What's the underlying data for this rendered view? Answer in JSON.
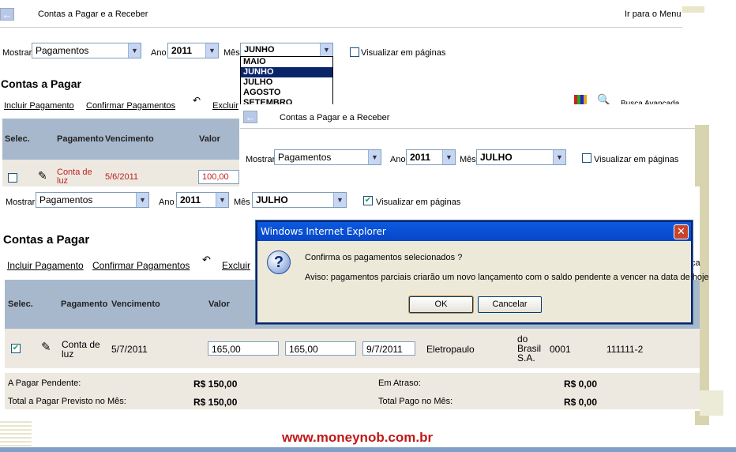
{
  "p1": {
    "title": "Contas a Pagar e a Receber",
    "menu": "Ir para o Menu",
    "mostrar_label": "Mostrar",
    "mostrar_val": "Pagamentos",
    "ano_label": "Ano",
    "ano_val": "2011",
    "mes_label": "Mês",
    "mes_val": "JUNHO",
    "vis_label": "Visualizar em páginas",
    "dropdown": [
      "MAIO",
      "JUNHO",
      "JULHO",
      "AGOSTO",
      "SETEMBRO"
    ],
    "heading": "Contas a Pagar",
    "incluir": "Incluir Pagamento",
    "confirmar": "Confirmar Pagamentos",
    "excluir": "Excluir",
    "busca": "Busca Avançada",
    "cols": [
      "Selec.",
      "Pagamento",
      "Vencimento",
      "Valor"
    ],
    "row": {
      "name": "Conta de luz",
      "venc": "5/6/2011",
      "valor": "100,00"
    }
  },
  "p2": {
    "title": "Contas a Pagar e a Receber",
    "mostrar_label": "Mostrar",
    "mostrar_val": "Pagamentos",
    "ano_label": "Ano",
    "ano_val": "2011",
    "mes_label": "Mês",
    "mes_val": "JULHO",
    "vis_label": "Visualizar em páginas"
  },
  "p3": {
    "mostrar_label": "Mostrar",
    "mostrar_val": "Pagamentos",
    "ano_label": "Ano",
    "ano_val": "2011",
    "mes_label": "Mês",
    "mes_val": "JULHO",
    "vis_label": "Visualizar em páginas",
    "heading": "Contas a Pagar",
    "incluir": "Incluir Pagamento",
    "confirmar": "Confirmar Pagamentos",
    "excluir": "Excluir",
    "cols": [
      "Selec.",
      "Pagamento",
      "Vencimento",
      "Valor"
    ],
    "row": {
      "name": "Conta de luz",
      "venc": "5/7/2011",
      "valor1": "165,00",
      "valor2": "165,00",
      "data": "9/7/2011",
      "empresa": "Eletropaulo",
      "banco": "do Brasil S.A.",
      "agencia": "0001",
      "conta": "111111-2"
    },
    "sum": {
      "pendente_l": "A Pagar Pendente:",
      "pendente_v": "R$ 150,00",
      "total_l": "Total a Pagar Previsto no Mês:",
      "total_v": "R$ 150,00",
      "atraso_l": "Em Atraso:",
      "atraso_v": "R$ 0,00",
      "pago_l": "Total Pago no Mês:",
      "pago_v": "R$ 0,00"
    }
  },
  "dialog": {
    "title": "Windows Internet Explorer",
    "msg1": "Confirma os pagamentos selecionados ?",
    "msg2": "Aviso: pagamentos parciais criarão um novo lançamento com o saldo pendente a vencer na data de hoje",
    "ok": "OK",
    "cancel": "Cancelar"
  },
  "footer": "www.moneynob.com.br"
}
